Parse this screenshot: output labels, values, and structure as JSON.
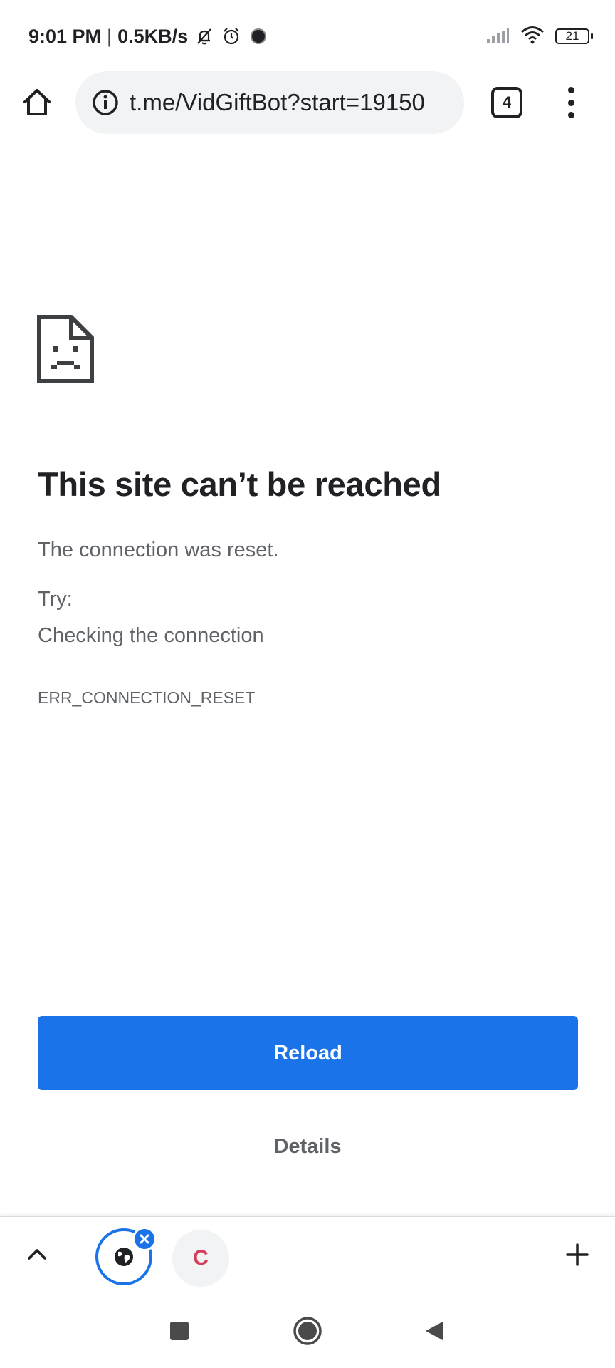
{
  "status_bar": {
    "time": "9:01 PM",
    "separator": "|",
    "speed": "0.5KB/s",
    "battery": "21"
  },
  "toolbar": {
    "url": "t.me/VidGiftBot?start=19150",
    "tab_count": "4"
  },
  "error": {
    "title": "This site can’t be reached",
    "description": "The connection was reset.",
    "try_label": "Try:",
    "suggestion": "Checking the connection",
    "code": "ERR_CONNECTION_RESET"
  },
  "buttons": {
    "reload_label": "Reload",
    "details_label": "Details"
  },
  "tab_strip": {
    "second_tab_letter": "C"
  },
  "colors": {
    "accent": "#1a73e8",
    "text_primary": "#202124",
    "text_secondary": "#5f6368",
    "omnibox_bg": "#f1f3f4",
    "favicon_letter": "#d23f5b"
  },
  "icons": {
    "status": [
      "notifications-off-icon",
      "alarm-icon",
      "record-icon",
      "signal-icon",
      "wifi-icon",
      "battery-icon"
    ],
    "toolbar": [
      "home-icon",
      "info-icon",
      "tab-switcher-icon",
      "more-vert-icon"
    ],
    "content": [
      "sad-page-icon"
    ],
    "tab_strip": [
      "chevron-up-icon",
      "globe-icon",
      "close-icon",
      "plus-icon"
    ],
    "navigation": [
      "recents-square-icon",
      "home-circle-icon",
      "back-triangle-icon"
    ]
  }
}
